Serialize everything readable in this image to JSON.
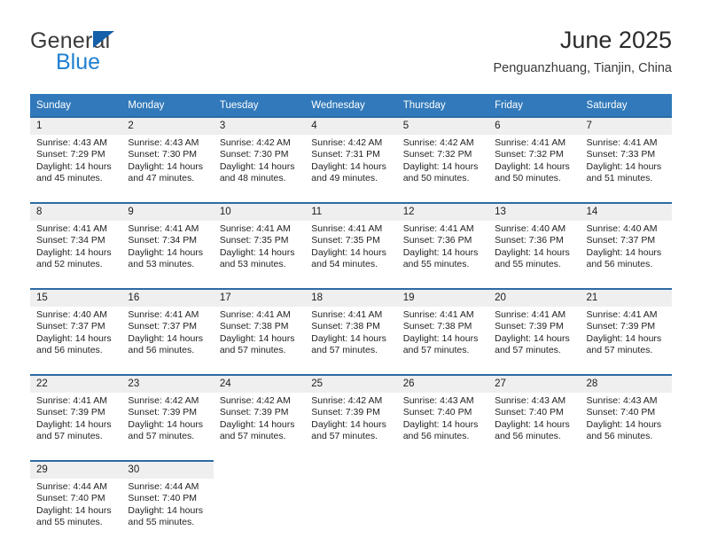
{
  "brand": {
    "word_one": "General",
    "word_two": "Blue",
    "triangle_icon": "brand-triangle-icon",
    "accent_color": "#1560a8",
    "secondary_color": "#1f7fd0"
  },
  "header": {
    "title": "June 2025",
    "subtitle": "Penguanzhuang, Tianjin, China"
  },
  "theme": {
    "header_bg": "#3179ba",
    "row_divider": "#2b6ca3",
    "daynum_bg": "#efefef",
    "cell_bg": "#ffffff"
  },
  "weekday_headers": [
    "Sunday",
    "Monday",
    "Tuesday",
    "Wednesday",
    "Thursday",
    "Friday",
    "Saturday"
  ],
  "weeks": [
    [
      {
        "day": "1",
        "sunrise": "Sunrise: 4:43 AM",
        "sunset": "Sunset: 7:29 PM",
        "daylight_1": "Daylight: 14 hours",
        "daylight_2": "and 45 minutes."
      },
      {
        "day": "2",
        "sunrise": "Sunrise: 4:43 AM",
        "sunset": "Sunset: 7:30 PM",
        "daylight_1": "Daylight: 14 hours",
        "daylight_2": "and 47 minutes."
      },
      {
        "day": "3",
        "sunrise": "Sunrise: 4:42 AM",
        "sunset": "Sunset: 7:30 PM",
        "daylight_1": "Daylight: 14 hours",
        "daylight_2": "and 48 minutes."
      },
      {
        "day": "4",
        "sunrise": "Sunrise: 4:42 AM",
        "sunset": "Sunset: 7:31 PM",
        "daylight_1": "Daylight: 14 hours",
        "daylight_2": "and 49 minutes."
      },
      {
        "day": "5",
        "sunrise": "Sunrise: 4:42 AM",
        "sunset": "Sunset: 7:32 PM",
        "daylight_1": "Daylight: 14 hours",
        "daylight_2": "and 50 minutes."
      },
      {
        "day": "6",
        "sunrise": "Sunrise: 4:41 AM",
        "sunset": "Sunset: 7:32 PM",
        "daylight_1": "Daylight: 14 hours",
        "daylight_2": "and 50 minutes."
      },
      {
        "day": "7",
        "sunrise": "Sunrise: 4:41 AM",
        "sunset": "Sunset: 7:33 PM",
        "daylight_1": "Daylight: 14 hours",
        "daylight_2": "and 51 minutes."
      }
    ],
    [
      {
        "day": "8",
        "sunrise": "Sunrise: 4:41 AM",
        "sunset": "Sunset: 7:34 PM",
        "daylight_1": "Daylight: 14 hours",
        "daylight_2": "and 52 minutes."
      },
      {
        "day": "9",
        "sunrise": "Sunrise: 4:41 AM",
        "sunset": "Sunset: 7:34 PM",
        "daylight_1": "Daylight: 14 hours",
        "daylight_2": "and 53 minutes."
      },
      {
        "day": "10",
        "sunrise": "Sunrise: 4:41 AM",
        "sunset": "Sunset: 7:35 PM",
        "daylight_1": "Daylight: 14 hours",
        "daylight_2": "and 53 minutes."
      },
      {
        "day": "11",
        "sunrise": "Sunrise: 4:41 AM",
        "sunset": "Sunset: 7:35 PM",
        "daylight_1": "Daylight: 14 hours",
        "daylight_2": "and 54 minutes."
      },
      {
        "day": "12",
        "sunrise": "Sunrise: 4:41 AM",
        "sunset": "Sunset: 7:36 PM",
        "daylight_1": "Daylight: 14 hours",
        "daylight_2": "and 55 minutes."
      },
      {
        "day": "13",
        "sunrise": "Sunrise: 4:40 AM",
        "sunset": "Sunset: 7:36 PM",
        "daylight_1": "Daylight: 14 hours",
        "daylight_2": "and 55 minutes."
      },
      {
        "day": "14",
        "sunrise": "Sunrise: 4:40 AM",
        "sunset": "Sunset: 7:37 PM",
        "daylight_1": "Daylight: 14 hours",
        "daylight_2": "and 56 minutes."
      }
    ],
    [
      {
        "day": "15",
        "sunrise": "Sunrise: 4:40 AM",
        "sunset": "Sunset: 7:37 PM",
        "daylight_1": "Daylight: 14 hours",
        "daylight_2": "and 56 minutes."
      },
      {
        "day": "16",
        "sunrise": "Sunrise: 4:41 AM",
        "sunset": "Sunset: 7:37 PM",
        "daylight_1": "Daylight: 14 hours",
        "daylight_2": "and 56 minutes."
      },
      {
        "day": "17",
        "sunrise": "Sunrise: 4:41 AM",
        "sunset": "Sunset: 7:38 PM",
        "daylight_1": "Daylight: 14 hours",
        "daylight_2": "and 57 minutes."
      },
      {
        "day": "18",
        "sunrise": "Sunrise: 4:41 AM",
        "sunset": "Sunset: 7:38 PM",
        "daylight_1": "Daylight: 14 hours",
        "daylight_2": "and 57 minutes."
      },
      {
        "day": "19",
        "sunrise": "Sunrise: 4:41 AM",
        "sunset": "Sunset: 7:38 PM",
        "daylight_1": "Daylight: 14 hours",
        "daylight_2": "and 57 minutes."
      },
      {
        "day": "20",
        "sunrise": "Sunrise: 4:41 AM",
        "sunset": "Sunset: 7:39 PM",
        "daylight_1": "Daylight: 14 hours",
        "daylight_2": "and 57 minutes."
      },
      {
        "day": "21",
        "sunrise": "Sunrise: 4:41 AM",
        "sunset": "Sunset: 7:39 PM",
        "daylight_1": "Daylight: 14 hours",
        "daylight_2": "and 57 minutes."
      }
    ],
    [
      {
        "day": "22",
        "sunrise": "Sunrise: 4:41 AM",
        "sunset": "Sunset: 7:39 PM",
        "daylight_1": "Daylight: 14 hours",
        "daylight_2": "and 57 minutes."
      },
      {
        "day": "23",
        "sunrise": "Sunrise: 4:42 AM",
        "sunset": "Sunset: 7:39 PM",
        "daylight_1": "Daylight: 14 hours",
        "daylight_2": "and 57 minutes."
      },
      {
        "day": "24",
        "sunrise": "Sunrise: 4:42 AM",
        "sunset": "Sunset: 7:39 PM",
        "daylight_1": "Daylight: 14 hours",
        "daylight_2": "and 57 minutes."
      },
      {
        "day": "25",
        "sunrise": "Sunrise: 4:42 AM",
        "sunset": "Sunset: 7:39 PM",
        "daylight_1": "Daylight: 14 hours",
        "daylight_2": "and 57 minutes."
      },
      {
        "day": "26",
        "sunrise": "Sunrise: 4:43 AM",
        "sunset": "Sunset: 7:40 PM",
        "daylight_1": "Daylight: 14 hours",
        "daylight_2": "and 56 minutes."
      },
      {
        "day": "27",
        "sunrise": "Sunrise: 4:43 AM",
        "sunset": "Sunset: 7:40 PM",
        "daylight_1": "Daylight: 14 hours",
        "daylight_2": "and 56 minutes."
      },
      {
        "day": "28",
        "sunrise": "Sunrise: 4:43 AM",
        "sunset": "Sunset: 7:40 PM",
        "daylight_1": "Daylight: 14 hours",
        "daylight_2": "and 56 minutes."
      }
    ],
    [
      {
        "day": "29",
        "sunrise": "Sunrise: 4:44 AM",
        "sunset": "Sunset: 7:40 PM",
        "daylight_1": "Daylight: 14 hours",
        "daylight_2": "and 55 minutes."
      },
      {
        "day": "30",
        "sunrise": "Sunrise: 4:44 AM",
        "sunset": "Sunset: 7:40 PM",
        "daylight_1": "Daylight: 14 hours",
        "daylight_2": "and 55 minutes."
      },
      null,
      null,
      null,
      null,
      null
    ]
  ]
}
